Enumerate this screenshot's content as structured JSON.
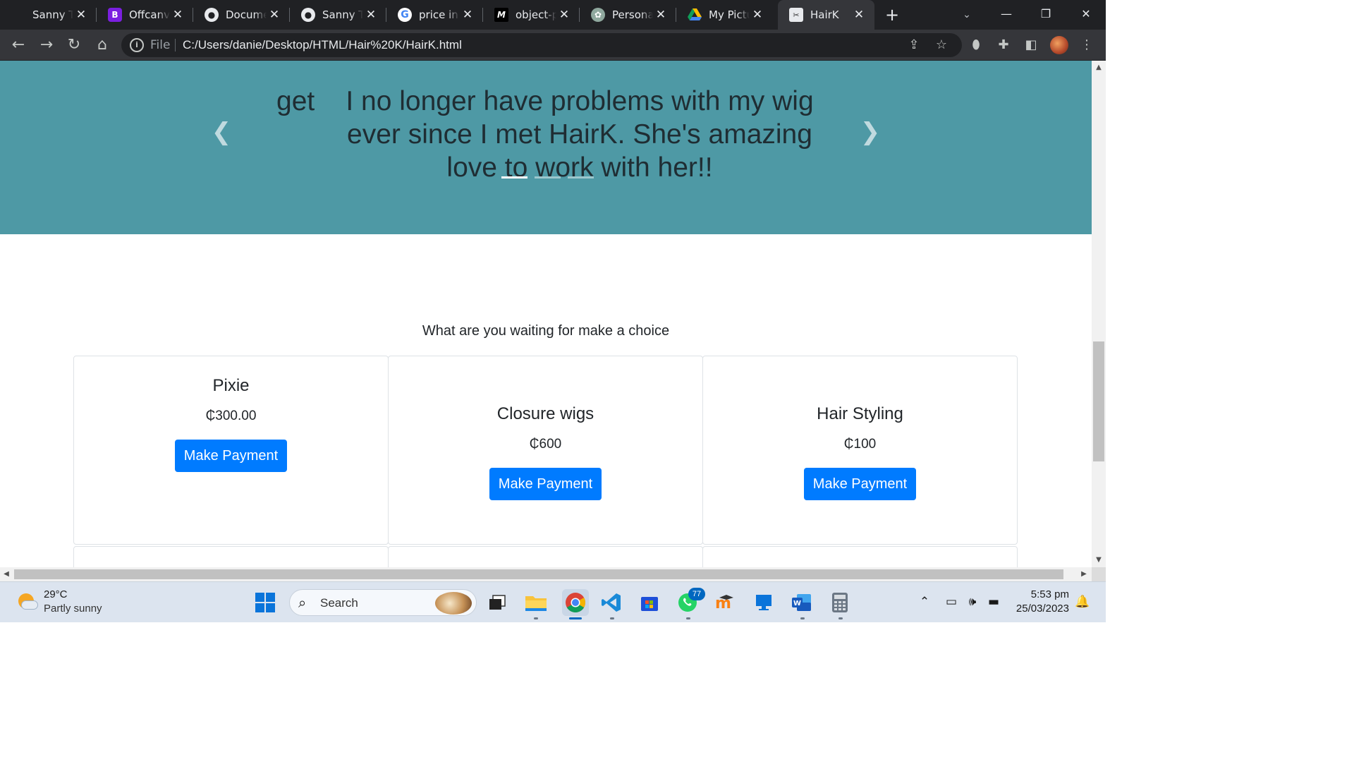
{
  "browser": {
    "tabs": [
      {
        "title": "Sanny Te",
        "icon": "globe-icon"
      },
      {
        "title": "Offcanva",
        "icon": "bootstrap-icon"
      },
      {
        "title": "Documen",
        "icon": "globe-icon"
      },
      {
        "title": "Sanny Te",
        "icon": "globe-icon"
      },
      {
        "title": "price in I",
        "icon": "google-icon"
      },
      {
        "title": "object-p",
        "icon": "medium-icon"
      },
      {
        "title": "Personal",
        "icon": "openai-icon"
      },
      {
        "title": "My Pictu",
        "icon": "drive-icon"
      },
      {
        "title": "HairK",
        "icon": "page-favicon",
        "active": true
      }
    ],
    "address": {
      "scheme_label": "File",
      "url": "C:/Users/danie/Desktop/HTML/Hair%20K/HairK.html"
    }
  },
  "page": {
    "carousel": {
      "peek_text": "get",
      "slide_text": "I no longer have problems with my wig ever since I met HairK. She's amazing love to work with her!!",
      "indicator_count": 3,
      "active_indicator": 0
    },
    "section_heading": "What are you waiting for make a choice",
    "products": [
      {
        "name": "Pixie",
        "price": "₵300.00",
        "button": "Make Payment"
      },
      {
        "name": "Closure wigs",
        "price": "₵600",
        "button": "Make Payment"
      },
      {
        "name": "Hair Styling",
        "price": "₵100",
        "button": "Make Payment"
      }
    ]
  },
  "taskbar": {
    "weather": {
      "temp": "29°C",
      "desc": "Partly sunny"
    },
    "search_label": "Search",
    "whatsapp_badge": "77",
    "clock": {
      "time": "5:53 pm",
      "date": "25/03/2023"
    }
  },
  "colors": {
    "carousel_bg": "#4e99a5",
    "primary_button": "#007bff",
    "browser_dark": "#202124"
  }
}
